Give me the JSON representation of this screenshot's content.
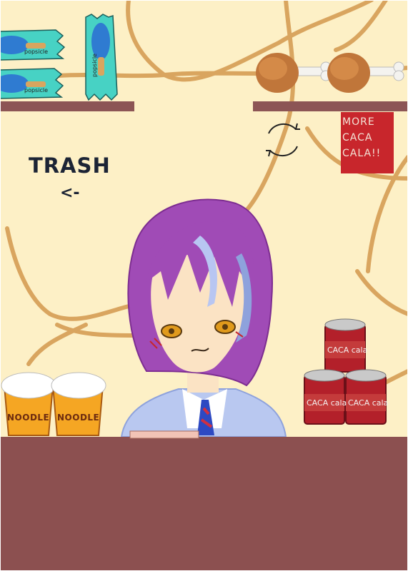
{
  "scene": {
    "trash_label": "TRASH",
    "trash_arrow": "<-",
    "sign_lines": [
      "MORE",
      "CACA",
      "CALA!!"
    ],
    "popsicle_text": "popsicle",
    "noodle_text": "NOODLE",
    "can_text": "CACA cala"
  },
  "colors": {
    "wall": "#fdf0c6",
    "counter": "#8c5050",
    "shelf": "#8c5555",
    "vines": "#d9a55f",
    "sign": "#c8262c",
    "popsicle_wrapper": "#47d2c4",
    "can": "#b3202a",
    "hair": "#a04bb6"
  },
  "icons": {
    "trash_arrow": "left-arrow",
    "refresh": "refresh-icon"
  }
}
